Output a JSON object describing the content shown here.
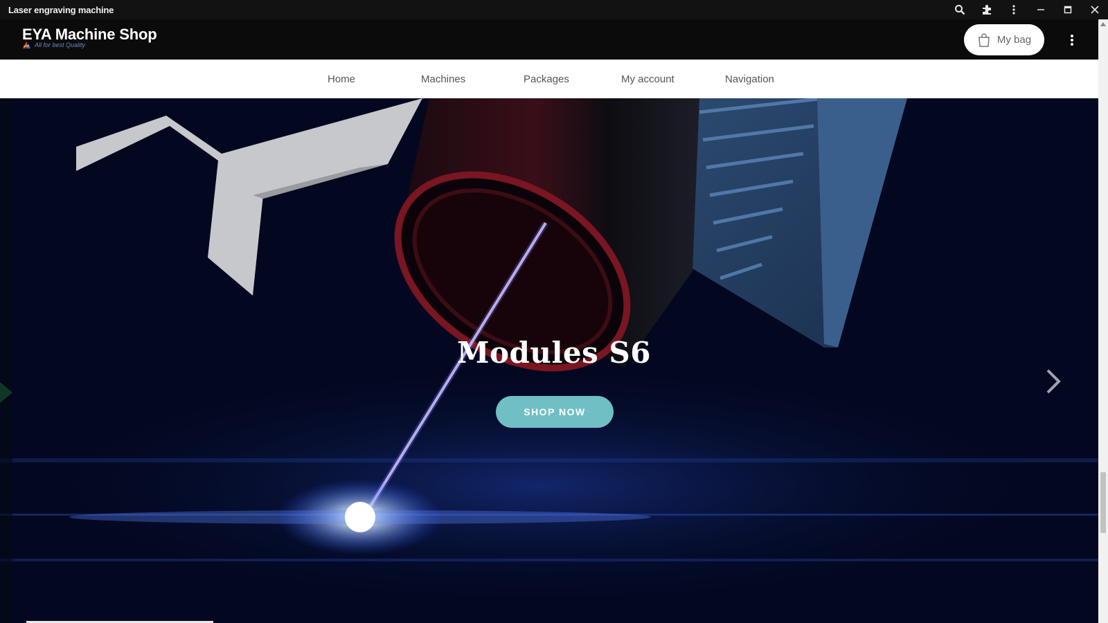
{
  "window": {
    "title": "Laser engraving machine",
    "icons": [
      "search-icon",
      "extension-icon",
      "more-vert-icon",
      "minimize-icon",
      "maximize-icon",
      "close-icon"
    ]
  },
  "header": {
    "brand": "EYA Machine Shop",
    "logo_tagline": "All for best Quality",
    "bag_label": "My bag",
    "bag_icon": "shopping-bag-icon",
    "menu_icon": "more-vert-icon"
  },
  "nav": {
    "items": [
      {
        "label": "Home"
      },
      {
        "label": "Machines"
      },
      {
        "label": "Packages"
      },
      {
        "label": "My account"
      },
      {
        "label": "Navigation"
      }
    ]
  },
  "hero": {
    "title": "Modules S6",
    "cta_label": "SHOP NOW",
    "next_icon": "chevron-right-icon",
    "slide_progress": 0.18,
    "accent_color": "#6fbfc4"
  }
}
